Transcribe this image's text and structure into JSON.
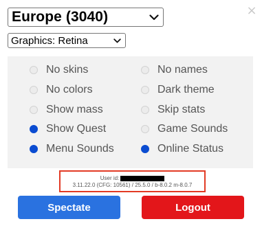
{
  "window": {
    "close_glyph": "×"
  },
  "region_select": {
    "value": "Europe (3040)"
  },
  "graphics_select": {
    "value": "Graphics: Retina"
  },
  "options": [
    {
      "label": "No skins",
      "checked": false
    },
    {
      "label": "No names",
      "checked": false
    },
    {
      "label": "No colors",
      "checked": false
    },
    {
      "label": "Dark theme",
      "checked": false
    },
    {
      "label": "Show mass",
      "checked": false
    },
    {
      "label": "Skip stats",
      "checked": false
    },
    {
      "label": "Show Quest",
      "checked": true
    },
    {
      "label": "Game Sounds",
      "checked": false
    },
    {
      "label": "Menu Sounds",
      "checked": true
    },
    {
      "label": "Online Status",
      "checked": true
    }
  ],
  "info": {
    "user_id_label": "User id:",
    "version": "3.11.22.0 (CFG: 10561) / 25.5.0 / b-8.0.2 m-8.0.7"
  },
  "buttons": {
    "spectate": "Spectate",
    "logout": "Logout"
  },
  "colors": {
    "radio_on": "#0b4cd1",
    "spectate_bg": "#2a72e0",
    "logout_bg": "#e3161a",
    "highlight_border": "#e23a24"
  }
}
